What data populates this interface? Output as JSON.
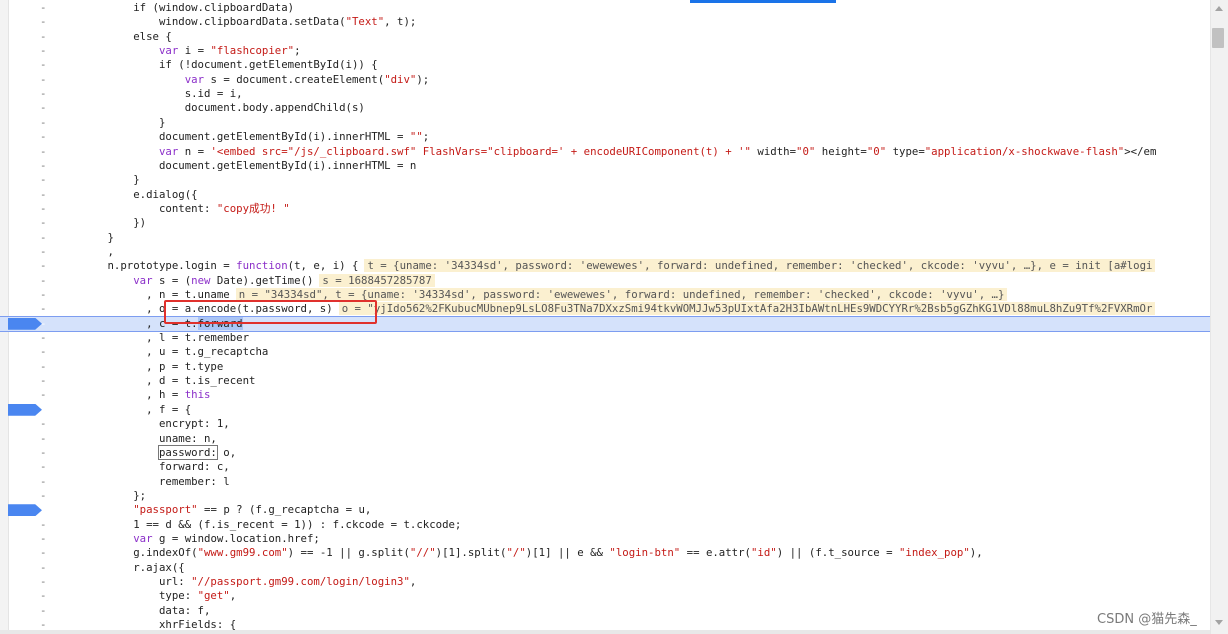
{
  "lines": [
    {
      "n": "-",
      "t": "            if (window.clipboardData)"
    },
    {
      "n": "-",
      "t": "                window.clipboardData.setData(\"Text\", t);"
    },
    {
      "n": "-",
      "t": "            else {"
    },
    {
      "n": "-",
      "t": "                var i = \"flashcopier\";"
    },
    {
      "n": "-",
      "t": "                if (!document.getElementById(i)) {"
    },
    {
      "n": "-",
      "t": "                    var s = document.createElement(\"div\");"
    },
    {
      "n": "-",
      "t": "                    s.id = i,"
    },
    {
      "n": "-",
      "t": "                    document.body.appendChild(s)"
    },
    {
      "n": "-",
      "t": "                }"
    },
    {
      "n": "-",
      "t": "                document.getElementById(i).innerHTML = \"\";"
    },
    {
      "n": "-",
      "t": "                var n = '<embed src=\"/js/_clipboard.swf\" FlashVars=\"clipboard=' + encodeURIComponent(t) + '\" width=\"0\" height=\"0\" type=\"application/x-shockwave-flash\"></em"
    },
    {
      "n": "-",
      "t": "                document.getElementById(i).innerHTML = n"
    },
    {
      "n": "-",
      "t": "            }"
    },
    {
      "n": "-",
      "t": "            e.dialog({"
    },
    {
      "n": "-",
      "t": "                content: \"copy成功! \""
    },
    {
      "n": "-",
      "t": "            })"
    },
    {
      "n": "-",
      "t": "        }"
    },
    {
      "n": "-",
      "t": "        ,"
    },
    {
      "n": "-",
      "t": "        n.prototype.login = function(t, e, i) {",
      "ev": "t = {uname: '34334sd', password: 'ewewewes', forward: undefined, remember: 'checked', ckcode: 'vyvu', …}, e = init [a#logi"
    },
    {
      "n": "-",
      "t": "            var s = (new Date).getTime()",
      "ev": "s = 1688457285787"
    },
    {
      "n": "-",
      "t": "              , n = t.uname",
      "ev": "n = \"34334sd\", t = {uname: '34334sd', password: 'ewewewes', forward: undefined, remember: 'checked', ckcode: 'vyvu', …}"
    },
    {
      "n": "-",
      "t": "              , o = a.encode(t.password, s)",
      "ev": "o = \"yjIdo562%2FKubucMUbnep9LsLO8Fu3TNa7DXxzSmi94tkvWOMJJw53pUIxtAfa2H3IbAWtnLHEs9WDCYYRr%2Bsb5gGZhKG1VDl88muL8hZu9Tf%2FVXRmOr"
    },
    {
      "n": "-",
      "t": "              , c = t.forward",
      "paused": true,
      "bp": true
    },
    {
      "n": "-",
      "t": "              , l = t.remember"
    },
    {
      "n": "-",
      "t": "              , u = t.g_recaptcha"
    },
    {
      "n": "-",
      "t": "              , p = t.type"
    },
    {
      "n": "-",
      "t": "              , d = t.is_recent"
    },
    {
      "n": "-",
      "t": "              , h = this"
    },
    {
      "n": "-",
      "t": "              , f = {",
      "bp": true
    },
    {
      "n": "-",
      "t": "                encrypt: 1,"
    },
    {
      "n": "-",
      "t": "                uname: n,"
    },
    {
      "n": "-",
      "t": "                password: o,"
    },
    {
      "n": "-",
      "t": "                forward: c,"
    },
    {
      "n": "-",
      "t": "                remember: l"
    },
    {
      "n": "-",
      "t": "            };"
    },
    {
      "n": "-",
      "t": "            \"passport\" == p ? (f.g_recaptcha = u,",
      "bp": true
    },
    {
      "n": "-",
      "t": "            1 == d && (f.is_recent = 1)) : f.ckcode = t.ckcode;"
    },
    {
      "n": "-",
      "t": "            var g = window.location.href;"
    },
    {
      "n": "-",
      "t": "            g.indexOf(\"www.gm99.com\") == -1 || g.split(\"//\")[1].split(\"/\")[1] || e && \"login-btn\" == e.attr(\"id\") || (f.t_source = \"index_pop\"),"
    },
    {
      "n": "-",
      "t": "            r.ajax({"
    },
    {
      "n": "-",
      "t": "                url: \"//passport.gm99.com/login/login3\","
    },
    {
      "n": "-",
      "t": "                type: \"get\","
    },
    {
      "n": "-",
      "t": "                data: f,"
    },
    {
      "n": "-",
      "t": "                xhrFields: {"
    }
  ],
  "watermark": "CSDN @猫先森_",
  "colors": {
    "breakpoint": "#4a86f0",
    "paused_line": "#d5e2fb",
    "highlight_box": "#e0312d",
    "eval_bg": "#fbf0d0"
  }
}
